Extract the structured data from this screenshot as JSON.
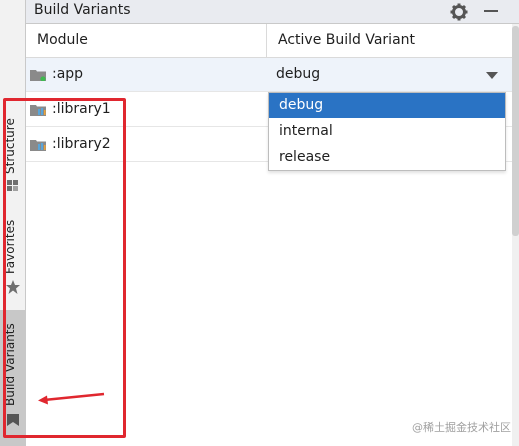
{
  "panel": {
    "title": "Build Variants"
  },
  "table": {
    "headers": {
      "module": "Module",
      "variant": "Active Build Variant"
    },
    "rows": [
      {
        "module": ":app",
        "variant": "debug"
      },
      {
        "module": ":library1"
      },
      {
        "module": ":library2"
      }
    ]
  },
  "dropdown": {
    "options": [
      "debug",
      "internal",
      "release"
    ],
    "selected": "debug"
  },
  "side_tabs": [
    {
      "label": "Structure"
    },
    {
      "label": "Favorites"
    },
    {
      "label": "Build Variants",
      "active": true
    }
  ],
  "watermark": "@稀土掘金技术社区",
  "colors": {
    "selection": "#2a73c4",
    "annotation": "#e0272f",
    "header_bg": "#e9ebf0",
    "active_tab": "#c8c8c8"
  },
  "icons": [
    "settings-gear-icon",
    "minimize-icon",
    "app-module-folder-icon",
    "library-module-folder-icon",
    "structure-icon",
    "favorites-star-icon",
    "build-variants-icon",
    "dropdown-arrow-icon"
  ]
}
